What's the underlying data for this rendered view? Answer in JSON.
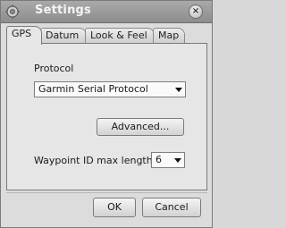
{
  "window": {
    "title": "Settings",
    "close_glyph": "×",
    "app_icon": "gear-icon",
    "close_icon": "close-icon"
  },
  "tabs": [
    {
      "label": "GPS",
      "active": true
    },
    {
      "label": "Datum",
      "active": false
    },
    {
      "label": "Look & Feel",
      "active": false
    },
    {
      "label": "Map",
      "active": false
    }
  ],
  "gps": {
    "protocol_label": "Protocol",
    "protocol_value": "Garmin Serial Protocol",
    "advanced_label": "Advanced...",
    "waypoint_label": "Waypoint ID max length:",
    "waypoint_value": "6"
  },
  "buttons": {
    "ok": "OK",
    "cancel": "Cancel"
  }
}
